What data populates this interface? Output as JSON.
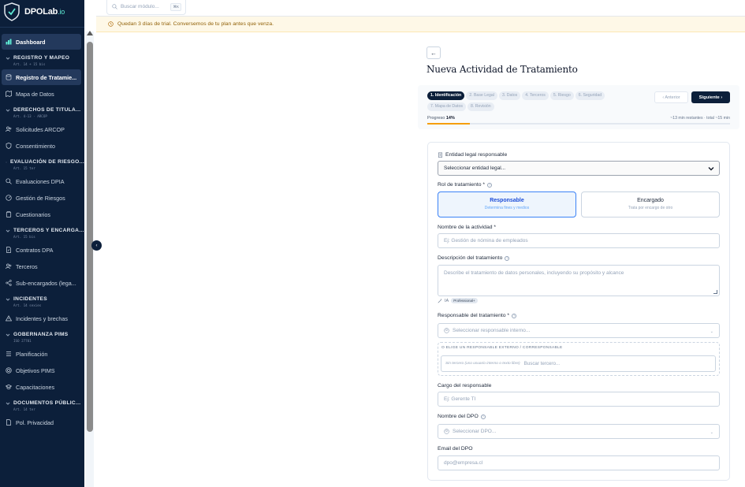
{
  "brand": {
    "name": "DPOLab",
    "tld": ".io"
  },
  "sidebar": {
    "dashboard": "Dashboard",
    "sections": [
      {
        "title": "REGISTRO Y MAPEO",
        "sub": "Art. 14 + 15 bis",
        "items": [
          "Registro de Tratamie...",
          "Mapa de Datos"
        ]
      },
      {
        "title": "DERECHOS DE TITULA...",
        "sub": "Art. 4-13 · ARCOP",
        "items": [
          "Solicitudes ARCOP",
          "Consentimiento"
        ]
      },
      {
        "title": "EVALUACIÓN DE RIESGO...",
        "sub": "Art. 15 ter",
        "items": [
          "Evaluaciones DPIA",
          "Gestión de Riesgos",
          "Cuestionarios"
        ]
      },
      {
        "title": "TERCEROS Y ENCARGA...",
        "sub": "Art. 15 bis",
        "items": [
          "Contratos DPA",
          "Terceros",
          "Sub-encargados (lega..."
        ]
      },
      {
        "title": "INCIDENTES",
        "sub": "Art. 14 sexies",
        "items": [
          "Incidentes y brechas"
        ]
      },
      {
        "title": "GOBERNANZA PIMS",
        "sub": "ISO 27701",
        "items": [
          "Planificación",
          "Objetivos PIMS",
          "Capacitaciones"
        ]
      },
      {
        "title": "DOCUMENTOS PÚBLIC...",
        "sub": "Art. 14 ter",
        "items": [
          "Pol. Privacidad"
        ]
      }
    ]
  },
  "topbar": {
    "search_placeholder": "Buscar módulo...",
    "shortcut": "⌘K"
  },
  "trial_banner": "Quedan 3 días de trial. Conversemos de tu plan antes que venza.",
  "page": {
    "back": "←",
    "title": "Nueva Actividad de Tratamiento",
    "steps": [
      "1. Identificación",
      "2. Base Legal",
      "3. Datos",
      "4. Terceros",
      "5. Riesgo",
      "6. Seguridad",
      "7. Mapa de Datos",
      "8. Revisión"
    ],
    "prev": "‹  Anterior",
    "next": "Siguiente  ›",
    "progress_label": "Progreso",
    "progress_value": "14%",
    "progress_fraction": 0.14,
    "time_left": "~13 min restantes · total ~15 min"
  },
  "form": {
    "legal_entity_label": "Entidad legal responsable",
    "legal_entity_value": "Seleccionar entidad legal...",
    "role_label": "Rol de tratamiento *",
    "role_options": [
      {
        "title": "Responsable",
        "sub": "Determina fines y medios"
      },
      {
        "title": "Encargado",
        "sub": "Trata por encargo de otro"
      }
    ],
    "activity_label": "Nombre de la actividad *",
    "activity_placeholder": "Ej: Gestión de nómina de empleados",
    "description_label": "Descripción del tratamiento",
    "description_placeholder": "Describe el tratamiento de datos personales, incluyendo su propósito y alcance",
    "ia_label": "IA",
    "ia_badge": "Professional+",
    "owner_label": "Responsable del tratamiento *",
    "owner_placeholder": "Seleccionar responsable interno...",
    "external_title": "O ELIGE UN RESPONSABLE EXTERNO / CORRESPONSABLE",
    "external_hint": "Sin tercero (uso usuario interno o texto libre)",
    "external_placeholder": "Buscar tercero...",
    "position_label": "Cargo del responsable",
    "position_placeholder": "Ej: Gerente TI",
    "dpo_label": "Nombre del DPO",
    "dpo_placeholder": "Seleccionar DPO...",
    "dpo_email_label": "Email del DPO",
    "dpo_email_placeholder": "dpo@empresa.cl"
  }
}
